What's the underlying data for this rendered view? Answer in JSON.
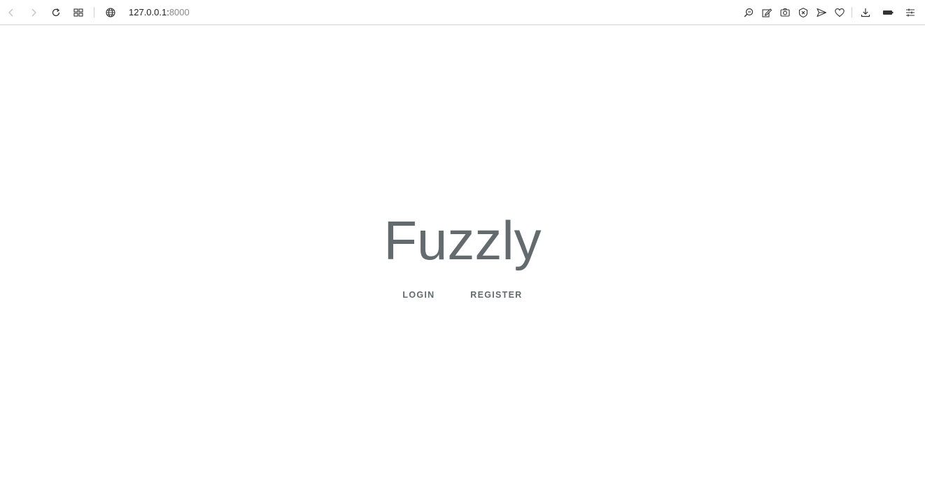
{
  "browser": {
    "url_host": "127.0.0.1:",
    "url_port": "8000"
  },
  "page": {
    "title": "Fuzzly",
    "links": {
      "login": "LOGIN",
      "register": "REGISTER"
    }
  },
  "colors": {
    "text": "#636b6f",
    "background": "#ffffff"
  },
  "icons": [
    "back-icon",
    "forward-icon",
    "reload-icon",
    "tabs-grid-icon",
    "globe-icon",
    "zoom-icon",
    "edit-icon",
    "camera-icon",
    "block-icon",
    "send-icon",
    "heart-icon",
    "download-icon",
    "battery-icon",
    "settings-sliders-icon"
  ]
}
